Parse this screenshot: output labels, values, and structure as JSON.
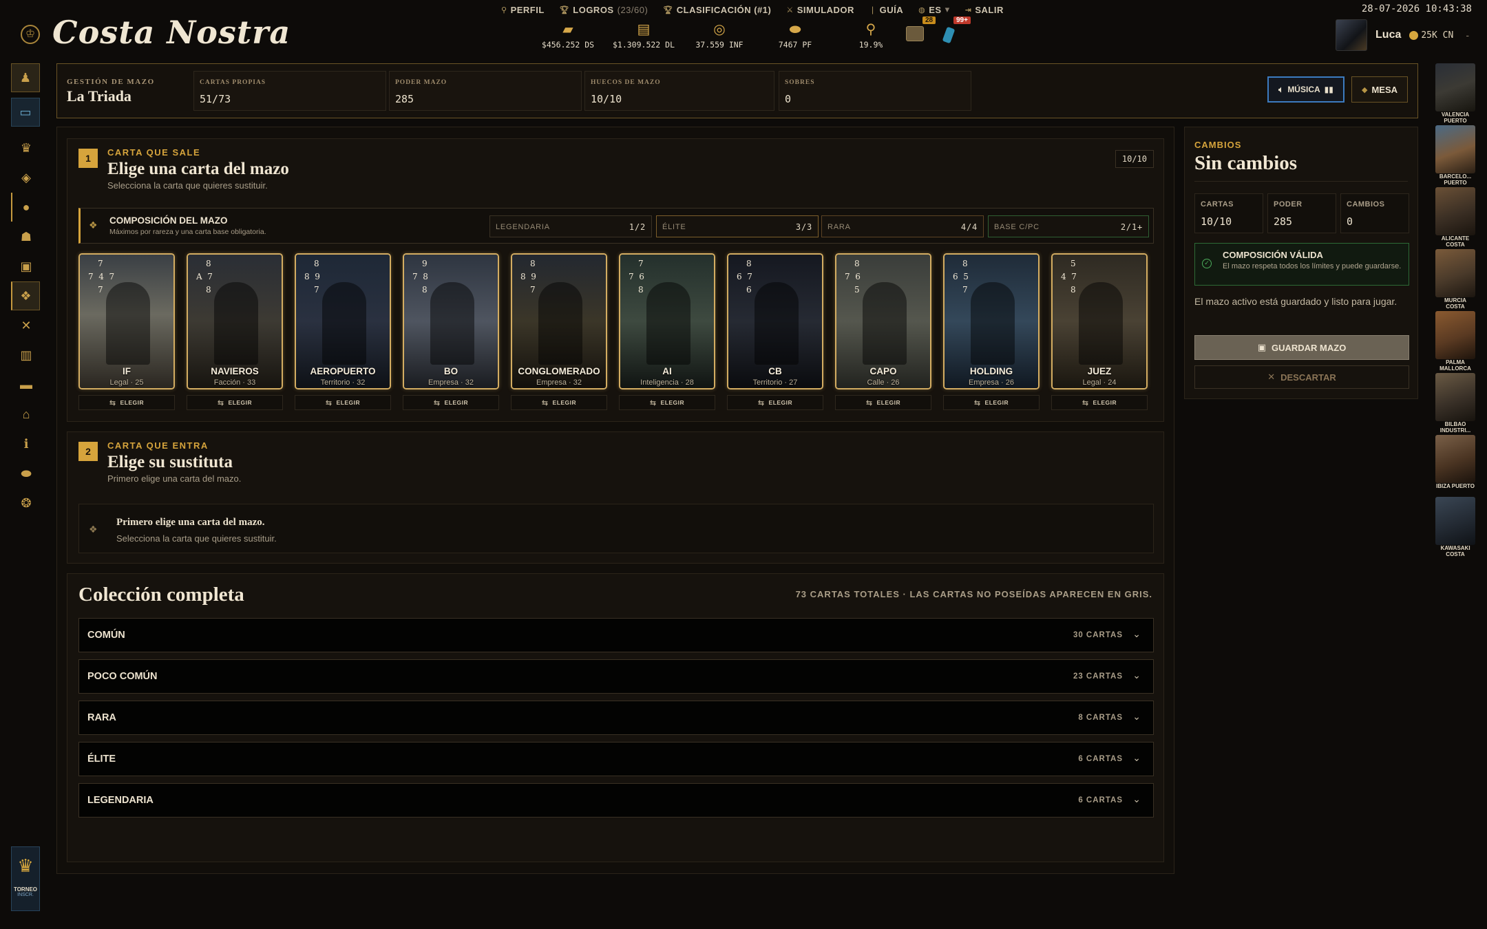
{
  "app": {
    "logo": "Costa Nostra"
  },
  "topnav": [
    {
      "icon": "person-icon",
      "label": "PERFIL",
      "extra": ""
    },
    {
      "icon": "trophy-icon",
      "label": "LOGROS",
      "extra": "(23/60)"
    },
    {
      "icon": "trophy-icon",
      "label": "CLASIFICACIÓN (#1)",
      "extra": ""
    },
    {
      "icon": "swords-icon",
      "label": "SIMULADOR",
      "extra": ""
    },
    {
      "icon": "book-icon",
      "label": "GUÍA",
      "extra": ""
    },
    {
      "icon": "globe-icon",
      "label": "ES",
      "extra": "▾"
    },
    {
      "icon": "logout-icon",
      "label": "SALIR",
      "extra": ""
    }
  ],
  "resources": [
    "$456.252 DS",
    "$1.309.522 DL",
    "37.559 INF",
    "7467 PF",
    "19.9%"
  ],
  "badges": {
    "inbox": "28",
    "phone": "99+"
  },
  "clock": "28-07-2026 10:43:38",
  "user": {
    "name": "Luca",
    "coins": "25K CN",
    "menu": "-"
  },
  "tournament": {
    "label": "TORNEO",
    "sub": "INSCR."
  },
  "cities": [
    {
      "label": "VALENCIA PUERTO"
    },
    {
      "label": "BARCELO... PUERTO"
    },
    {
      "label": "ALICANTE COSTA"
    },
    {
      "label": "MURCIA COSTA"
    },
    {
      "label": "PALMA MALLORCA"
    },
    {
      "label": "BILBAO INDUSTRI..."
    },
    {
      "label": "IBIZA PUERTO"
    },
    {
      "label": "KAWASAKI COSTA"
    }
  ],
  "header": {
    "subtitle": "GESTIÓN DE MAZO",
    "title": "La Triada",
    "stats": [
      {
        "label": "CARTAS PROPIAS",
        "value": "51/73"
      },
      {
        "label": "PODER MAZO",
        "value": "285"
      },
      {
        "label": "HUECOS DE MAZO",
        "value": "10/10"
      },
      {
        "label": "SOBRES",
        "value": "0"
      }
    ],
    "music_label": "MÚSICA",
    "mesa_label": "MESA"
  },
  "step1": {
    "num": "1",
    "label": "CARTA QUE SALE",
    "title": "Elige una carta del mazo",
    "sub": "Selecciona la carta que quieres sustituir.",
    "count": "10/10",
    "composition": {
      "title": "COMPOSICIÓN DEL MAZO",
      "sub": "Máximos por rareza y una carta base obligatoria.",
      "rarities": [
        {
          "label": "LEGENDARIA",
          "value": "1/2"
        },
        {
          "label": "ÉLITE",
          "value": "3/3"
        },
        {
          "label": "RARA",
          "value": "4/4"
        },
        {
          "label": "BASE C/PC",
          "value": "2/1+"
        }
      ]
    },
    "choose_label": "ELEGIR",
    "cards": [
      {
        "name": "IF",
        "meta": "Legal · 25",
        "nums": [
          "7",
          "7  4  7",
          "7"
        ]
      },
      {
        "name": "NAVIEROS",
        "meta": "Facción · 33",
        "nums": [
          "8",
          "A  7",
          "8"
        ]
      },
      {
        "name": "AEROPUERTO",
        "meta": "Territorio · 32",
        "nums": [
          "8",
          "8  9",
          "7"
        ]
      },
      {
        "name": "BO",
        "meta": "Empresa · 32",
        "nums": [
          "9",
          "7  8",
          "8"
        ]
      },
      {
        "name": "CONGLOMERADO",
        "meta": "Empresa · 32",
        "nums": [
          "8",
          "8  9",
          "7"
        ]
      },
      {
        "name": "AI",
        "meta": "Inteligencia · 28",
        "nums": [
          "7",
          "7  6",
          "8"
        ]
      },
      {
        "name": "CB",
        "meta": "Territorio · 27",
        "nums": [
          "8",
          "6  7",
          "6"
        ]
      },
      {
        "name": "CAPO",
        "meta": "Calle · 26",
        "nums": [
          "8",
          "7  6",
          "5"
        ]
      },
      {
        "name": "HOLDING",
        "meta": "Empresa · 26",
        "nums": [
          "8",
          "6  5",
          "7"
        ]
      },
      {
        "name": "JUEZ",
        "meta": "Legal · 24",
        "nums": [
          "5",
          "4  7",
          "8"
        ]
      }
    ]
  },
  "step2": {
    "num": "2",
    "label": "CARTA QUE ENTRA",
    "title": "Elige su sustituta",
    "sub": "Primero elige una carta del mazo.",
    "empty_title": "Primero elige una carta del mazo.",
    "empty_sub": "Selecciona la carta que quieres sustituir."
  },
  "collection": {
    "title": "Colección completa",
    "note": "73 CARTAS TOTALES · LAS CARTAS NO POSEÍDAS APARECEN EN GRIS.",
    "rarities": [
      {
        "name": "COMÚN",
        "count": "30 CARTAS"
      },
      {
        "name": "POCO COMÚN",
        "count": "23 CARTAS"
      },
      {
        "name": "RARA",
        "count": "8 CARTAS"
      },
      {
        "name": "ÉLITE",
        "count": "6 CARTAS"
      },
      {
        "name": "LEGENDARIA",
        "count": "6 CARTAS"
      }
    ]
  },
  "changes": {
    "label": "CAMBIOS",
    "title": "Sin cambios",
    "stats": [
      {
        "label": "CARTAS",
        "value": "10/10"
      },
      {
        "label": "PODER",
        "value": "285"
      },
      {
        "label": "CAMBIOS",
        "value": "0"
      }
    ],
    "valid_title": "COMPOSICIÓN VÁLIDA",
    "valid_sub": "El mazo respeta todos los límites y puede guardarse.",
    "info": "El mazo activo está guardado y listo para jugar.",
    "save_label": "GUARDAR MAZO",
    "discard_label": "DESCARTAR"
  },
  "colors": {
    "accent": "#d6a43c",
    "valid": "#4cae5c",
    "music_border": "#3c7bc0",
    "card_border": "#d4ad62"
  }
}
